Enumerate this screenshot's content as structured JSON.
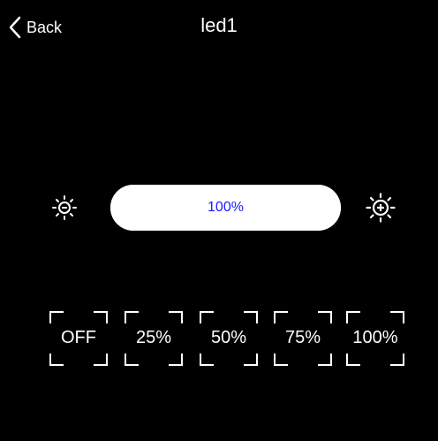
{
  "header": {
    "back_label": "Back",
    "title": "led1"
  },
  "brightness": {
    "label": "100%",
    "level_percent": 100,
    "decrease_icon": "sun-minus-icon",
    "increase_icon": "sun-plus-icon",
    "label_color": "#1a1aff"
  },
  "presets": [
    {
      "label": "OFF"
    },
    {
      "label": "25%"
    },
    {
      "label": "50%"
    },
    {
      "label": "75%"
    },
    {
      "label": "100%"
    }
  ],
  "colors": {
    "background": "#000000",
    "foreground": "#ffffff",
    "accent": "#1a1aff"
  }
}
